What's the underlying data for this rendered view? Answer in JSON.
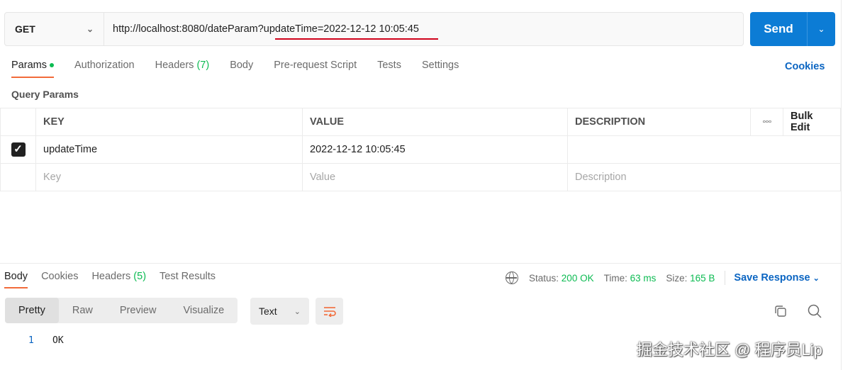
{
  "request": {
    "method": "GET",
    "url": "http://localhost:8080/dateParam?updateTime=2022-12-12 10:05:45",
    "send_label": "Send"
  },
  "request_tabs": [
    {
      "label": "Params",
      "active": true
    },
    {
      "label": "Authorization"
    },
    {
      "label": "Headers",
      "count": "(7)"
    },
    {
      "label": "Body"
    },
    {
      "label": "Pre-request Script"
    },
    {
      "label": "Tests"
    },
    {
      "label": "Settings"
    }
  ],
  "cookies_label": "Cookies",
  "query_params": {
    "title": "Query Params",
    "headers": {
      "key": "KEY",
      "value": "VALUE",
      "description": "DESCRIPTION",
      "bulk_edit": "Bulk Edit"
    },
    "rows": [
      {
        "checked": true,
        "key": "updateTime",
        "value": "2022-12-12 10:05:45",
        "description": ""
      }
    ],
    "placeholders": {
      "key": "Key",
      "value": "Value",
      "description": "Description"
    }
  },
  "response_tabs": [
    {
      "label": "Body",
      "active": true
    },
    {
      "label": "Cookies"
    },
    {
      "label": "Headers",
      "count": "(5)"
    },
    {
      "label": "Test Results"
    }
  ],
  "response_status": {
    "status_label": "Status:",
    "status_value": "200 OK",
    "time_label": "Time:",
    "time_value": "63 ms",
    "size_label": "Size:",
    "size_value": "165 B",
    "save_label": "Save Response"
  },
  "format_tabs": [
    "Pretty",
    "Raw",
    "Preview",
    "Visualize"
  ],
  "format_select": "Text",
  "response_body": {
    "line_number": "1",
    "code": "OK"
  },
  "watermark": "掘金技术社区 @ 程序员Lip",
  "colors": {
    "accent": "#f26b3a",
    "send": "#0c7cd5",
    "success": "#0cbb52",
    "link": "#0b65c2",
    "underline": "#d0021b"
  }
}
